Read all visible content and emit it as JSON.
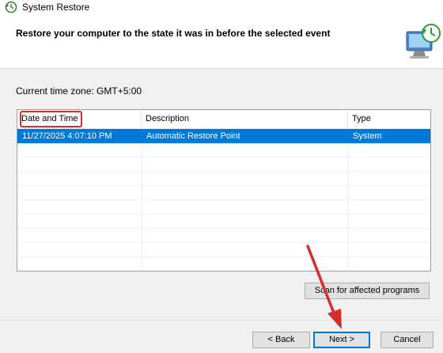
{
  "window": {
    "title": "System Restore"
  },
  "header": {
    "heading": "Restore your computer to the state it was in before the selected event"
  },
  "timezone": {
    "label": "Current time zone: GMT+5:00"
  },
  "table": {
    "columns": [
      "Date and Time",
      "Description",
      "Type"
    ],
    "rows": [
      {
        "date": "11/27/2025 4:07:10 PM",
        "description": "Automatic Restore Point",
        "type": "System",
        "selected": true
      }
    ]
  },
  "buttons": {
    "scan": "Scan for affected programs",
    "back": "< Back",
    "next": "Next >",
    "cancel": "Cancel"
  },
  "colors": {
    "selection": "#0078d7",
    "annotation": "#d32f2f"
  }
}
